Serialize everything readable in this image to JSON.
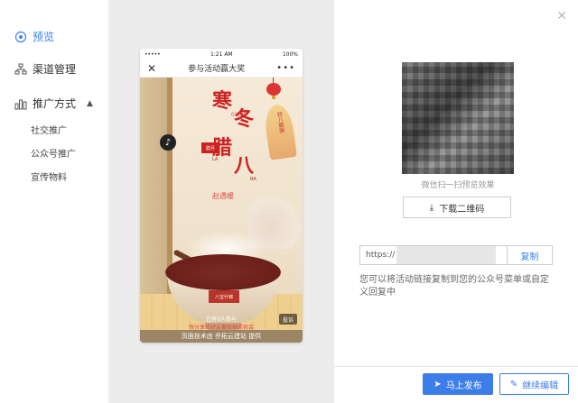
{
  "sidebar": {
    "items": [
      {
        "label": "预览",
        "icon": "eye-icon"
      },
      {
        "label": "渠道管理",
        "icon": "org-chart-icon"
      },
      {
        "label": "推广方式",
        "icon": "bar-chart-icon"
      }
    ],
    "sub_items": [
      {
        "label": "社交推广"
      },
      {
        "label": "公众号推广"
      },
      {
        "label": "宣传物料"
      }
    ]
  },
  "phone": {
    "status_left": "•••••",
    "status_time": "1:21 AM",
    "status_right": "100%",
    "title": "参与活动赢大奖",
    "poster": {
      "title_han": "寒",
      "title_dong": "冬",
      "title_la": "腊",
      "title_ba": "八",
      "date": "01/20",
      "month": "腊月",
      "la": "LA",
      "ba": "BA",
      "poem": "赵遇暖",
      "fan_text": "初八腊粥",
      "bowl_label": "八宝什锦",
      "caption_line1": "已有0人参与",
      "caption_line2": "快分享给好友赢取抽奖机会",
      "report": "投诉",
      "footer": "页面技术由 乔拓云建站 提供"
    }
  },
  "right": {
    "qr_caption": "微信扫一扫预览效果",
    "download_label": "下载二维码",
    "link_value": "https://",
    "copy_label": "复制",
    "hint": "您可以将活动链接复制到您的公众号菜单或自定义回复中",
    "publish_label": "马上发布",
    "edit_label": "继续编辑"
  },
  "colors": {
    "accent": "#3d7de8",
    "active": "#3b82f6",
    "stage_bg": "#ececec"
  }
}
